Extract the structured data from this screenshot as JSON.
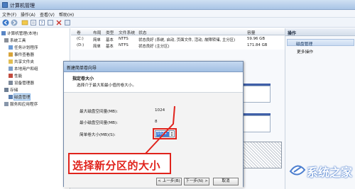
{
  "window": {
    "title": "计算机管理"
  },
  "menu": [
    "文件(F)",
    "操作(A)",
    "查看(V)",
    "帮助(H)"
  ],
  "toolbar_icons": [
    "back-icon",
    "forward-icon",
    "up-icon",
    "properties-icon",
    "help-icon",
    "more-icon",
    "delete-icon",
    "refresh-icon"
  ],
  "tree": {
    "root": "计算机管理(本地)",
    "items": [
      "系统工具",
      "任务计划程序",
      "事件查看器",
      "共享文件夹",
      "本地用户和组",
      "性能",
      "设备管理器",
      "存储",
      "磁盘管理",
      "服务和应用程序"
    ]
  },
  "table": {
    "headers": [
      "卷",
      "布局",
      "类型",
      "文件系统",
      "状态",
      "容量"
    ],
    "rows": [
      [
        "(C:)",
        "简单",
        "基本",
        "NTFS",
        "状态良好 (系统, 启动, 页面文件, 活动, 故障转储, 主分区)",
        "59.96 GB"
      ],
      [
        "(D:)",
        "简单",
        "基本",
        "NTFS",
        "状态良好 (主分区)",
        "171.84 GB"
      ]
    ]
  },
  "actions": {
    "header": "操作",
    "selected": "磁盘管理",
    "more": "更多操作"
  },
  "wizard": {
    "title": "新建简单卷向导",
    "heading": "指定卷大小",
    "subheading": "选择介于最大和最小值的卷大小。",
    "max_label": "最大磁盘空间量(MB):",
    "max_value": "1024",
    "min_label": "最小磁盘空间量(MB):",
    "min_value": "8",
    "size_label": "简单卷大小(MB)(S):",
    "size_value": "1024",
    "back_button": "< 上一步(B)",
    "next_button": "下一步(N) >",
    "cancel_button": "取消"
  },
  "annotation": {
    "text": "选择新分区的大小"
  },
  "watermark": {
    "text": "系统之家"
  },
  "colors": {
    "annotation_red": "#e0231c",
    "title_blue": "#a9c4e6",
    "selection_blue": "#3d7fd9"
  }
}
